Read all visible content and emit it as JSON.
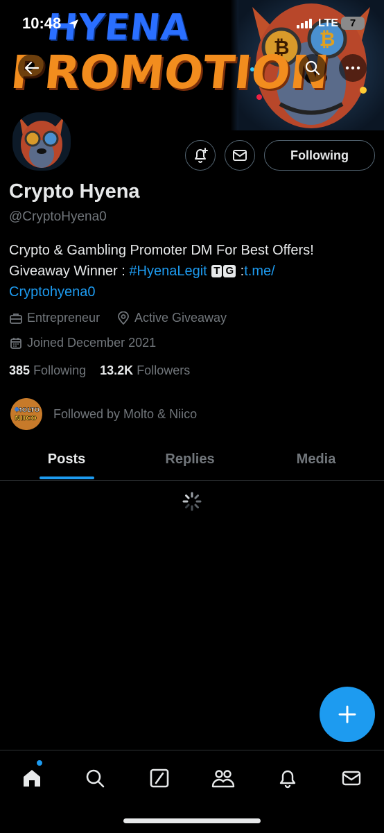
{
  "status_bar": {
    "time": "10:48",
    "network": "LTE",
    "battery": "7"
  },
  "banner": {
    "line1": "HYENA",
    "line2": "PROMOTION"
  },
  "profile": {
    "follow_state_label": "Following",
    "display_name": "Crypto Hyena",
    "handle": "@CryptoHyena0",
    "bio_line1": "Crypto & Gambling Promoter DM For Best Offers!",
    "bio_prefix": "Giveaway Winner : ",
    "bio_hashtag": "#HyenaLegit",
    "bio_badge_1": "T",
    "bio_badge_2": "G",
    "bio_link_sep": " :",
    "bio_link_1": "t.me/",
    "bio_link_2": "Cryptohyena0",
    "category": "Entrepreneur",
    "location": "Active Giveaway",
    "joined": "Joined December 2021",
    "following_count": "385",
    "following_label": "Following",
    "followers_count": "13.2K",
    "followers_label": "Followers",
    "followed_by": "Followed by Molto & Niico",
    "followed_avatar_text_1": "MOLTO",
    "followed_avatar_text_2": "NIICO"
  },
  "tabs": [
    {
      "label": "Posts",
      "selected": true
    },
    {
      "label": "Replies",
      "selected": false
    },
    {
      "label": "Media",
      "selected": false
    }
  ],
  "colors": {
    "accent": "#1d9bf0",
    "background": "#000000",
    "text": "#e7e9ea",
    "muted": "#71767b"
  },
  "icons": [
    "back-arrow-icon",
    "search-icon",
    "more-icon",
    "notification-bell-plus-icon",
    "mail-icon",
    "briefcase-icon",
    "location-pin-icon",
    "calendar-icon",
    "spinner-icon",
    "plus-icon",
    "home-icon",
    "search-icon",
    "grok-icon",
    "communities-icon",
    "bell-icon",
    "mail-icon"
  ]
}
